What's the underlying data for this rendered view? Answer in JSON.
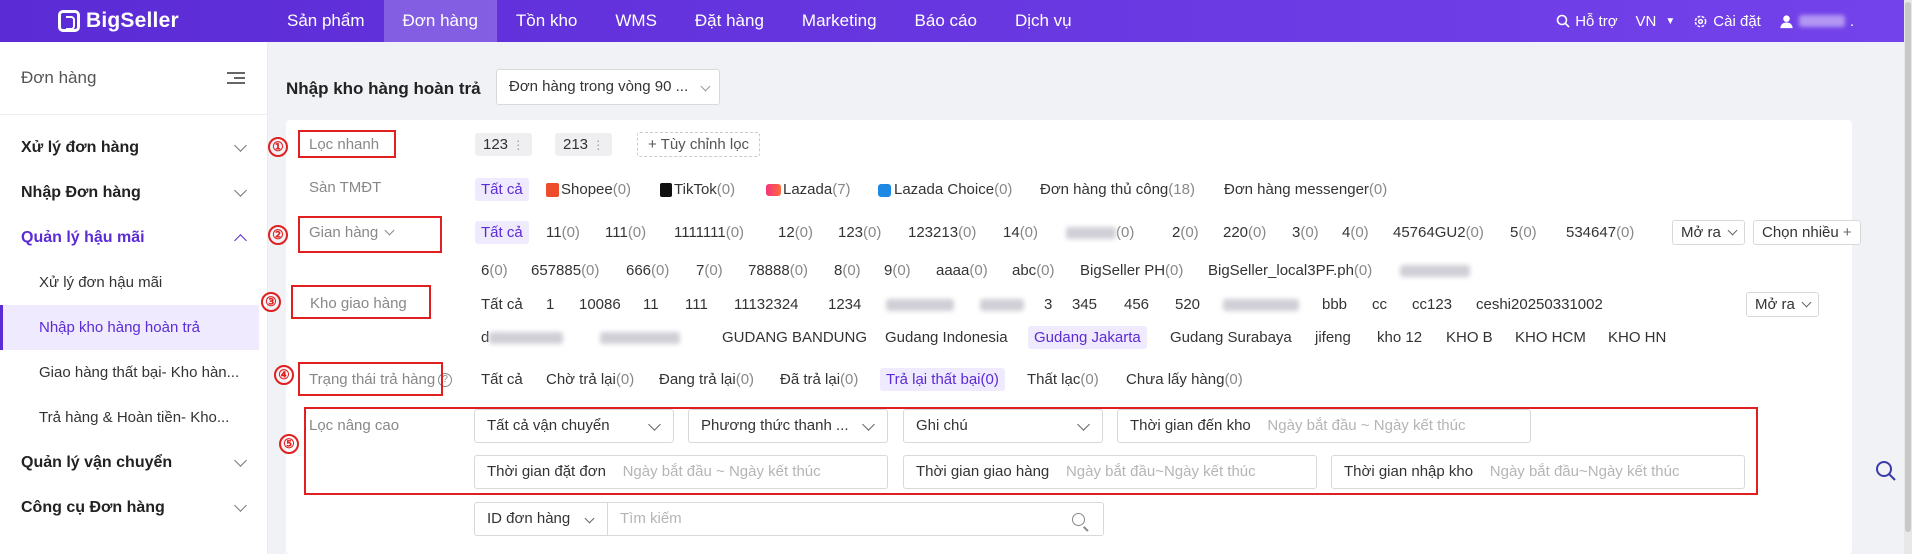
{
  "app": {
    "logo": "BigSeller"
  },
  "nav": {
    "items": [
      "Sản phẩm",
      "Đơn hàng",
      "Tồn kho",
      "WMS",
      "Đặt hàng",
      "Marketing",
      "Báo cáo",
      "Dịch vụ"
    ],
    "active": "Đơn hàng",
    "support": "Hỗ trợ",
    "lang": "VN",
    "settings": "Cài đặt",
    "user_suffix": "."
  },
  "sidebar": {
    "title": "Đơn hàng",
    "groups": [
      {
        "label": "Xử lý đơn hàng"
      },
      {
        "label": "Nhập Đơn hàng"
      },
      {
        "label": "Quản lý hậu mãi"
      },
      {
        "label": "Quản lý vận chuyển"
      },
      {
        "label": "Công cụ Đơn hàng"
      }
    ],
    "sub_items": [
      {
        "label": "Xử lý đơn hậu mãi"
      },
      {
        "label": "Nhập kho hàng hoàn trả"
      },
      {
        "label": "Giao hàng thất bại- Kho hàn..."
      },
      {
        "label": "Trả hàng & Hoàn tiền- Kho..."
      }
    ]
  },
  "page": {
    "title": "Nhập kho hàng hoàn trả",
    "range_select": "Đơn hàng trong vòng 90 ..."
  },
  "filters": {
    "quick": {
      "label": "Lọc nhanh",
      "chips": [
        "123",
        "213"
      ],
      "custom_btn": "+ Tùy chỉnh lọc"
    },
    "platform": {
      "label": "Sàn TMĐT",
      "all": "Tất cả",
      "options": [
        {
          "name": "Shopee",
          "count": "(0)"
        },
        {
          "name": "TikTok",
          "count": "(0)"
        },
        {
          "name": "Lazada",
          "count": "(7)"
        },
        {
          "name": "Lazada Choice",
          "count": "(0)"
        },
        {
          "name": "Đơn hàng thủ công",
          "count": "(18)"
        },
        {
          "name": "Đơn hàng messenger",
          "count": "(0)"
        }
      ]
    },
    "store": {
      "label": "Gian hàng",
      "all": "Tất cả",
      "row1": [
        {
          "name": "11",
          "count": "(0)"
        },
        {
          "name": "111",
          "count": "(0)"
        },
        {
          "name": "1111111",
          "count": "(0)"
        },
        {
          "name": "12",
          "count": "(0)"
        },
        {
          "name": "123",
          "count": "(0)"
        },
        {
          "name": "123213",
          "count": "(0)"
        },
        {
          "name": "14",
          "count": "(0)"
        },
        {
          "name": "",
          "count": "(0)"
        },
        {
          "name": "2",
          "count": "(0)"
        },
        {
          "name": "220",
          "count": "(0)"
        },
        {
          "name": "3",
          "count": "(0)"
        },
        {
          "name": "4",
          "count": "(0)"
        },
        {
          "name": "45764GU2",
          "count": "(0)"
        },
        {
          "name": "5",
          "count": "(0)"
        },
        {
          "name": "534647",
          "count": "(0)"
        }
      ],
      "row2": [
        {
          "name": "6",
          "count": "(0)"
        },
        {
          "name": "657885",
          "count": "(0)"
        },
        {
          "name": "666",
          "count": "(0)"
        },
        {
          "name": "7",
          "count": "(0)"
        },
        {
          "name": "78888",
          "count": "(0)"
        },
        {
          "name": "8",
          "count": "(0)"
        },
        {
          "name": "9",
          "count": "(0)"
        },
        {
          "name": "aaaa",
          "count": "(0)"
        },
        {
          "name": "abc",
          "count": "(0)"
        },
        {
          "name": "BigSeller PH",
          "count": "(0)"
        },
        {
          "name": "BigSeller_local3PF.ph",
          "count": "(0)"
        }
      ],
      "expand": "Mở ra",
      "multi": "Chọn nhiều"
    },
    "warehouse": {
      "label": "Kho giao hàng",
      "row1": [
        "Tất cả",
        "1",
        "10086",
        "11",
        "111",
        "11132324",
        "1234",
        "",
        "",
        "3",
        "345",
        "456",
        "520",
        "",
        "bbb",
        "cc",
        "cc123",
        "ceshi20250331002"
      ],
      "row2": [
        "",
        "",
        "GUDANG BANDUNG",
        "Gudang Indonesia",
        "Gudang Jakarta",
        "Gudang Surabaya",
        "jifeng",
        "kho 12",
        "KHO B",
        "KHO HCM",
        "KHO HN"
      ],
      "row2_prefix": "d",
      "selected": "Gudang Jakarta",
      "expand": "Mở ra"
    },
    "status": {
      "label": "Trạng thái trả hàng",
      "help": "?",
      "all": "Tất cả",
      "options": [
        {
          "name": "Chờ trả lại",
          "count": "(0)"
        },
        {
          "name": "Đang trả lại",
          "count": "(0)"
        },
        {
          "name": "Đã trả lại",
          "count": "(0)"
        },
        {
          "name": "Trả lại thất bại",
          "count": "(0)"
        },
        {
          "name": "Thất lạc",
          "count": "(0)"
        },
        {
          "name": "Chưa lấy hàng",
          "count": "(0)"
        }
      ],
      "selected": "Trả lại thất bại"
    },
    "advanced": {
      "label": "Lọc nâng cao",
      "shipping": "Tất cả vận chuyển",
      "payment": "Phương thức thanh ...",
      "note": "Ghi chú",
      "arrive_label": "Thời gian đến kho",
      "order_label": "Thời gian đặt đơn",
      "ship_label": "Thời gian giao hàng",
      "import_label": "Thời gian nhập kho",
      "start_ph": "Ngày bắt đầu",
      "end_ph": "Ngày kết thúc",
      "sep": "~"
    },
    "search": {
      "type": "ID đơn hàng",
      "placeholder": "Tìm kiếm"
    }
  },
  "markers": [
    "①",
    "②",
    "③",
    "④",
    "⑤"
  ],
  "colors": {
    "brand": "#5b2bd6",
    "annotation": "#e02020",
    "selected_bg": "#efeafd"
  }
}
